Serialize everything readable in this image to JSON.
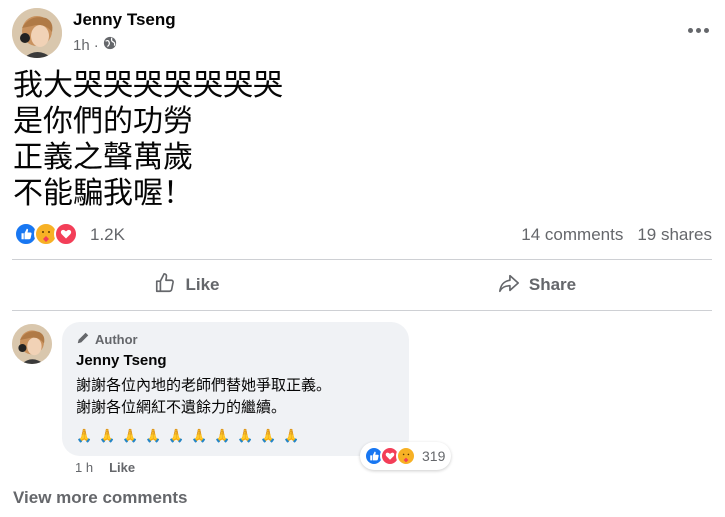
{
  "post": {
    "author": "Jenny Tseng",
    "time": "1h",
    "privacy_icon": "globe-icon",
    "lines": [
      "我大哭哭哭哭哭哭哭",
      "是你們的功勞",
      "正義之聲萬歲",
      "不能騙我喔！"
    ]
  },
  "stats": {
    "reaction_icons": [
      "like-icon",
      "care-icon",
      "love-icon"
    ],
    "reactions": "1.2K",
    "comments": "14 comments",
    "shares": "19 shares"
  },
  "actions": {
    "like": "Like",
    "share": "Share"
  },
  "comment": {
    "badge": "Author",
    "name": "Jenny Tseng",
    "lines": [
      "謝謝各位內地的老師們替她爭取正義。",
      "謝謝各位網紅不遺餘力的繼續。"
    ],
    "emoji": [
      "🙏",
      "🙏",
      "🙏",
      "🙏",
      "🙏",
      "🙏",
      "🙏",
      "🙏",
      "🙏",
      "🙏"
    ],
    "reaction_icons": [
      "like-icon",
      "love-icon",
      "care-icon"
    ],
    "reactions": "319",
    "time": "1 h",
    "like_label": "Like"
  },
  "footer": {
    "view_more": "View more comments"
  },
  "colors": {
    "like_blue": "#1877f2",
    "love_red": "#f33e58",
    "care_yellow": "#f7b125",
    "secondary_text": "#65676b",
    "bubble_bg": "#f0f2f5"
  }
}
